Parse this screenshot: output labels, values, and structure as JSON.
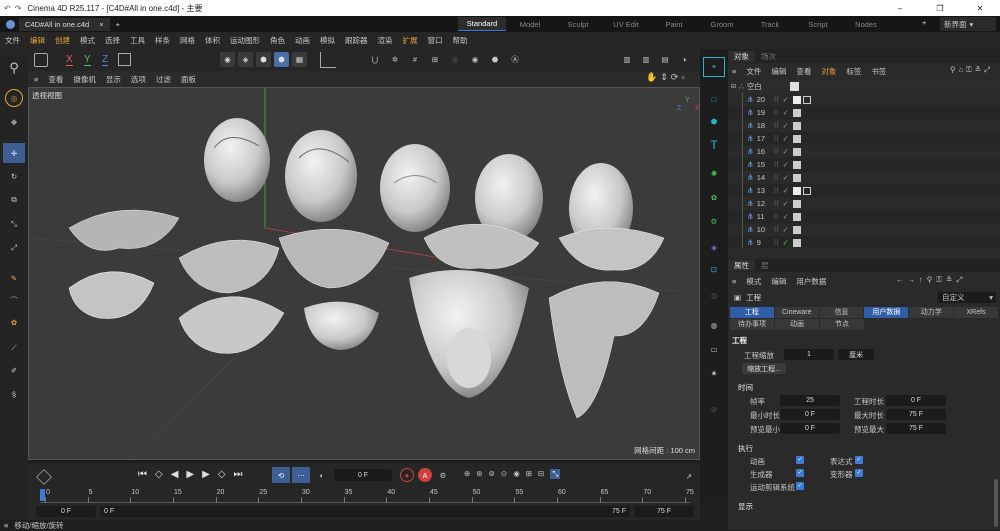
{
  "window": {
    "title": "Cinema 4D R25.117 - [C4D#All in one.c4d] - 主要",
    "controls": [
      "–",
      "❐",
      "✕"
    ]
  },
  "doc_tab": {
    "label": "C4D#All in one.c4d",
    "plus": "+"
  },
  "layouts": [
    "Standard",
    "Model",
    "Sculpt",
    "UV Edit",
    "Paint",
    "Groom",
    "Track",
    "Script",
    "Nodes"
  ],
  "layout_extra": {
    "plus": "+",
    "new_ui": "新界面"
  },
  "menu": [
    "文件",
    "编辑",
    "创建",
    "模式",
    "选择",
    "工具",
    "样条",
    "网格",
    "体积",
    "运动图形",
    "角色",
    "动画",
    "模拟",
    "跟踪器",
    "渲染",
    "扩展",
    "窗口",
    "帮助"
  ],
  "axes": {
    "x": "X",
    "y": "Y",
    "z": "Z"
  },
  "viewport_menu": [
    "查看",
    "摄像机",
    "显示",
    "选项",
    "过滤",
    "面板"
  ],
  "viewport": {
    "label": "透视视图",
    "grid_spacing": "网格间距 : 100 cm"
  },
  "timeline": {
    "current_frame": "0 F",
    "ruler": [
      "0",
      "5",
      "10",
      "15",
      "20",
      "25",
      "30",
      "35",
      "40",
      "45",
      "50",
      "55",
      "60",
      "65",
      "70",
      "75"
    ],
    "start": "0 F",
    "start2": "0 F",
    "end": "75 F",
    "end2": "75 F"
  },
  "status": "移动/缩放/旋转",
  "objects_tabs": [
    "对象",
    "场次"
  ],
  "objects_menu": [
    "文件",
    "编辑",
    "查看",
    "对象",
    "标签",
    "书签"
  ],
  "objects": {
    "root": "空白",
    "items": [
      "20",
      "19",
      "18",
      "17",
      "16",
      "15",
      "14",
      "13",
      "12",
      "11",
      "10",
      "9"
    ]
  },
  "attr_tabs": [
    "属性",
    "层"
  ],
  "attr_menu": [
    "模式",
    "编辑",
    "用户数据"
  ],
  "attr": {
    "heading": "工程",
    "dropdown": "自定义",
    "tabs1": [
      "工程",
      "Cineware",
      "信息",
      "用户数据",
      "动力学",
      "XRefs"
    ],
    "tabs2": [
      "待办事项",
      "动画",
      "节点"
    ],
    "section": "工程",
    "scale_label": "工程缩放",
    "scale_value": "1",
    "scale_unit": "厘米",
    "scale_btn": "缩放工程...",
    "time_title": "时间",
    "fps_label": "帧率",
    "fps_value": "25",
    "duration_label": "工程时长",
    "duration_value": "0 F",
    "min_label": "最小时长",
    "min_value": "0 F",
    "max_label": "最大时长",
    "max_value": "75 F",
    "pmin_label": "预览最小",
    "pmin_value": "0 F",
    "pmax_label": "预览最大",
    "pmax_value": "75 F",
    "exec_title": "执行",
    "anim_label": "动画",
    "expr_label": "表达式",
    "gen_label": "生成器",
    "deform_label": "变形器",
    "mograph_label": "运动剪辑系统",
    "display_title": "显示"
  },
  "colors": {
    "accent": "#3d7bd6",
    "active_tab": "#2f5da8",
    "orange": "#e8a13a",
    "green": "#45c45a",
    "teal": "#2bb5c9"
  }
}
